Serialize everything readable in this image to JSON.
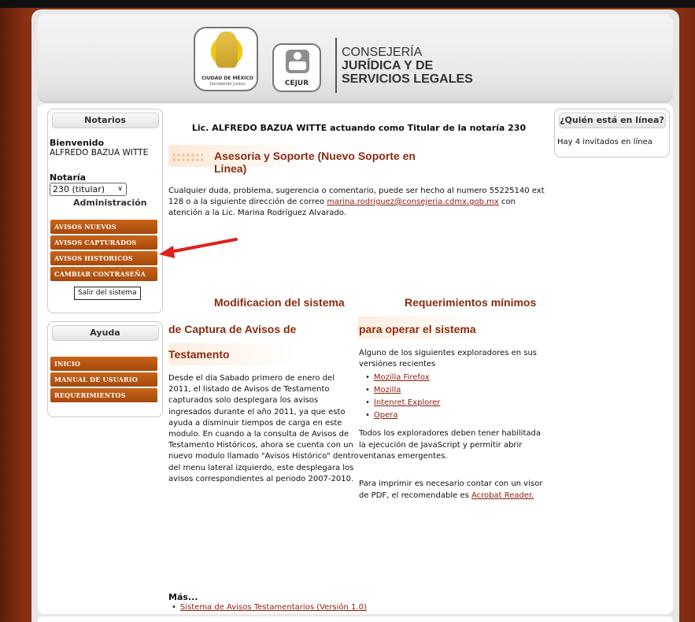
{
  "header": {
    "cdmx_logo_title": "CIUDAD DE MÉXICO",
    "cdmx_logo_sub": "Decidiendo Juntos",
    "cejur_label": "CEJUR",
    "title_line1": "CONSEJERÍA",
    "title_line2": "JURÍDICA Y DE",
    "title_line3": "SERVICIOS LEGALES"
  },
  "left": {
    "notarios_title": "Notarios",
    "welcome_label": "Bienvenido",
    "user_name": "ALFREDO BAZUA WITTE",
    "notaria_label": "Notaría",
    "notaria_selected": "230 (titular)",
    "admin_label": "Administración",
    "menu": [
      "AVISOS NUEVOS",
      "AVISOS CAPTURADOS",
      "AVISOS HISTORICOS",
      "CAMBIAR CONTRASEÑA"
    ],
    "logout_label": "Salir del sistema",
    "ayuda_title": "Ayuda",
    "help_menu": [
      "INICIO",
      "MANUAL DE USUARIO",
      "REQUERIMIENTOS"
    ]
  },
  "main": {
    "heading": "Lic. ALFREDO BAZUA WITTE actuando como Titular de la notaría 230",
    "support_title": "Asesoria y Soporte (Nuevo Soporte en Linea)",
    "support_text_1": "Cualquier duda, problema, sugerencia o comentario, puede ser hecho al numero 55225140 ext 128 o a la siguiente dirección de correo ",
    "support_email": "marina.rodriguez@consejeria.cdmx.gob.mx",
    "support_text_2": " con atención a la Lic. Marina Rodríguez Alvarado.",
    "mod_title_1": "Modificacion del sistema",
    "mod_title_2": "de Captura de Avisos de",
    "mod_title_3": "Testamento",
    "mod_text": "Desde el día Sabado primero de enero del 2011, el listado de Avisos de Testamento capturados solo desplegara los avisos ingresados durante el año 2011, ya que esto ayuda a disminuir tiempos de carga en este modulo. En cuando a la consulta de Avisos de Testamento Históricos, ahora se cuenta con un nuevo modulo llamado \"Avisos Histórico\" dentro del menu lateral izquierdo, este desplegara los avisos correspondientes al periodo 2007-2010.",
    "req_title_1": "Requerimientos mínimos",
    "req_title_2": "para operar el sistema",
    "req_intro": "Alguno de los siguientes exploradores en sus versiónes recientes",
    "browsers": [
      "Mozilla Firefox",
      "Mozilla",
      "Intenret Explorer",
      "Opera"
    ],
    "req_js": "Todos los exploradores deben tener habilitada la ejecución de JavaScript y permitir abrir ventanas emergentes.",
    "req_pdf": "Para imprimir es necesario contar con un visor de PDF, el recomendable es ",
    "req_pdf_link": "Acrobat Reader.",
    "more_label": "Más...",
    "more_link": "Sistema de Avisos Testamentarios (Versión 1.0)"
  },
  "right": {
    "online_title": "¿Quién está en línea?",
    "online_text": "Hay 4 invitados en línea"
  },
  "annotation": {
    "arrow_color": "#e0201a"
  }
}
